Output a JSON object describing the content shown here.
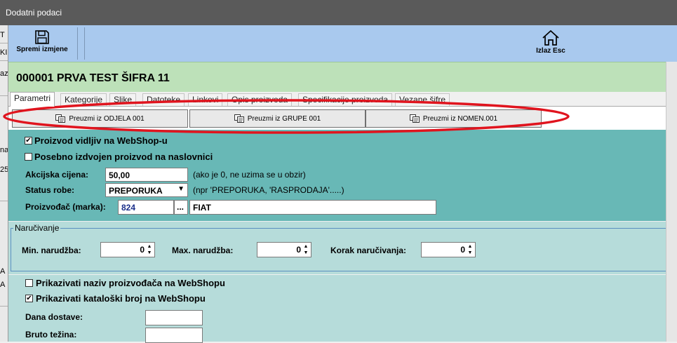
{
  "window": {
    "title": "Dodatni podaci"
  },
  "left_strip": [
    "T",
    "KI",
    "az",
    "na",
    "25",
    "A",
    "A"
  ],
  "toolbar": {
    "save_label": "Spremi izmjene",
    "exit_label": "Izlaz Esc"
  },
  "header": {
    "title": "000001 PRVA TEST ŠIFRA 11"
  },
  "tabs": [
    {
      "label": "Parametri",
      "active": true
    },
    {
      "label": "Kategorije"
    },
    {
      "label": "Slike"
    },
    {
      "label": "Datoteke"
    },
    {
      "label": "Linkovi"
    },
    {
      "label": "Opis proizvoda"
    },
    {
      "label": "Specifikacije proizvoda"
    },
    {
      "label": "Vezane šifre"
    }
  ],
  "fetch_buttons": [
    {
      "label": "Preuzmi iz ODJELA 001"
    },
    {
      "label": "Preuzmi iz GRUPE 001"
    },
    {
      "label": "Preuzmi iz NOMEN.001"
    }
  ],
  "params": {
    "visible_label": "Proizvod vidljiv na WebShop-u",
    "visible_checked": true,
    "featured_label": "Posebno izdvojen proizvod na naslovnici",
    "featured_checked": false,
    "action_price_label": "Akcijska cijena:",
    "action_price_value": "50,00",
    "action_price_note": "(ako je 0, ne uzima se u obzir)",
    "status_label": "Status robe:",
    "status_value": "PREPORUKA",
    "status_note": "(npr 'PREPORUKA, 'RASPRODAJA'.....)",
    "manufacturer_label": "Proizvođač (marka):",
    "manufacturer_code": "824",
    "manufacturer_browse": "...",
    "manufacturer_name": "FIAT"
  },
  "ordering": {
    "title": "Naručivanje",
    "min_label": "Min. narudžba:",
    "min_value": "0",
    "max_label": "Max. narudžba:",
    "max_value": "0",
    "step_label": "Korak naručivanja:",
    "step_value": "0"
  },
  "lower": {
    "show_manufacturer_label": "Prikazivati naziv proizvođača na WebShopu",
    "show_manufacturer_checked": false,
    "show_catalog_label": "Prikazivati kataloški broj na WebShopu",
    "show_catalog_checked": true,
    "delivery_days_label": "Dana dostave:",
    "delivery_days_value": "",
    "gross_weight_label": "Bruto težina:",
    "gross_weight_value": ""
  },
  "colors": {
    "annotation_ellipse": "#e0141e",
    "teal_panel": "#68b8b6",
    "toolbar": "#a9c9ee",
    "header": "#bde1b9"
  }
}
